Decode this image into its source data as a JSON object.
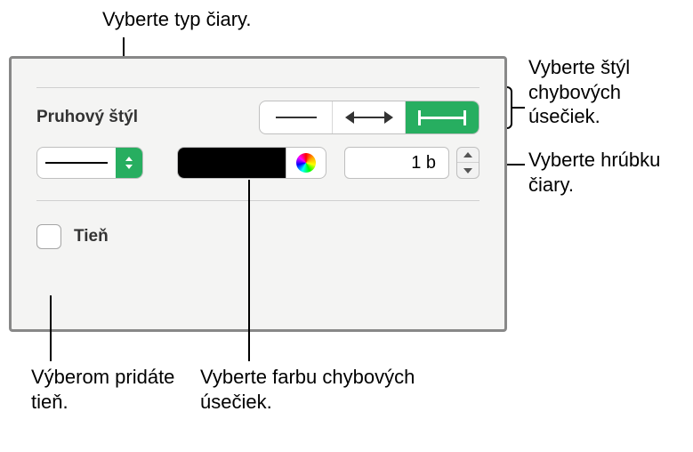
{
  "callouts": {
    "lineType": "Vyberte typ čiary.",
    "errorStyle": "Vyberte štýl chybových úsečiek.",
    "thickness": "Vyberte hrúbku čiary.",
    "shadow": "Výberom pridáte tieň.",
    "color": "Vyberte farbu chybových úsečiek."
  },
  "panel": {
    "sectionTitle": "Pruhový štýl",
    "lineThickness": "1 b",
    "shadowLabel": "Tieň",
    "swatchColor": "#000000"
  },
  "icons": {
    "seg1": "line-plain",
    "seg2": "line-arrow-caps",
    "seg3": "line-t-caps",
    "chevron": "chevron-updown",
    "colorwheel": "color-wheel"
  }
}
